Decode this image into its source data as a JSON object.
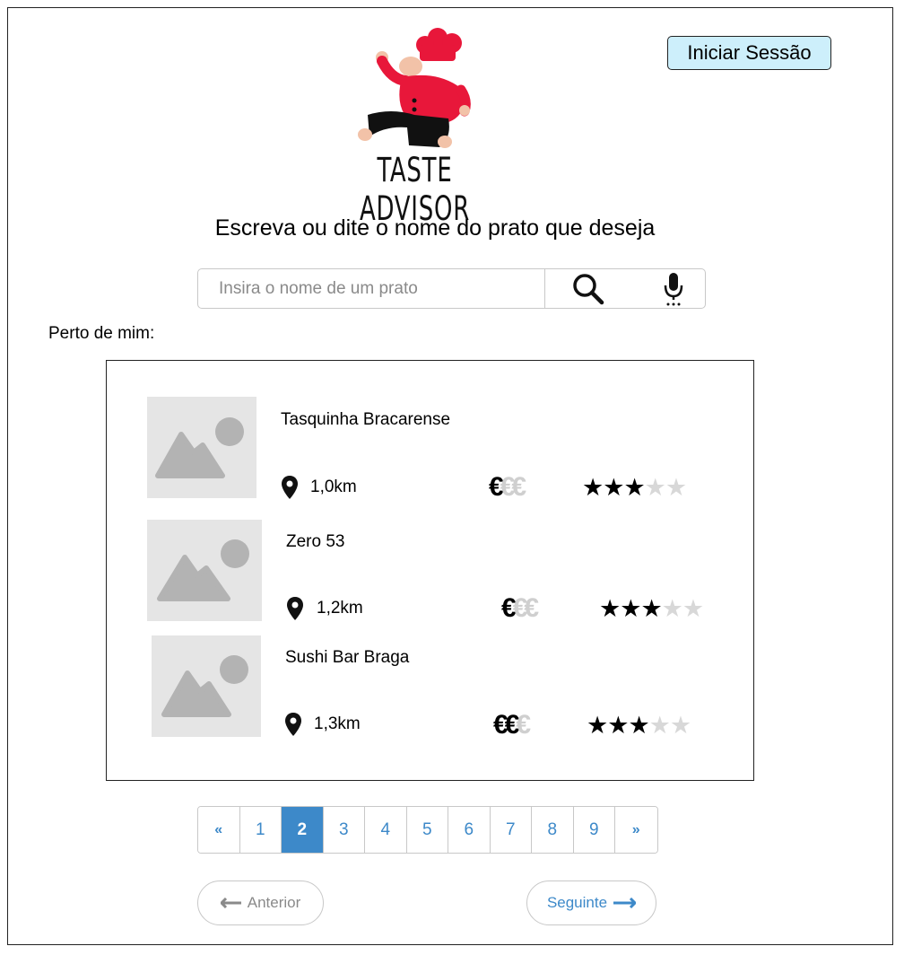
{
  "header": {
    "login_label": "Iniciar Sessão",
    "logo_text": "TASTE ADVISOR"
  },
  "search": {
    "prompt": "Escreva ou dite o nome do prato que deseja",
    "placeholder": "Insira o nome de um prato"
  },
  "near_me": {
    "label": "Perto de mim:",
    "restaurants": [
      {
        "name": "Tasquinha Bracarense",
        "distance": "1,0km",
        "price_level": 1,
        "price_max": 3,
        "rating": 3,
        "rating_max": 5
      },
      {
        "name": "Zero 53",
        "distance": "1,2km",
        "price_level": 1,
        "price_max": 3,
        "rating": 3,
        "rating_max": 5
      },
      {
        "name": "Sushi Bar Braga",
        "distance": "1,3km",
        "price_level": 2,
        "price_max": 3,
        "rating": 3,
        "rating_max": 5
      }
    ]
  },
  "pagination": {
    "first": "«",
    "pages": [
      "1",
      "2",
      "3",
      "4",
      "5",
      "6",
      "7",
      "8",
      "9"
    ],
    "last": "»",
    "current_page": "2"
  },
  "navigation": {
    "prev_label": "Anterior",
    "next_label": "Seguinte"
  },
  "colors": {
    "accent": "#3d89c9",
    "login_bg": "#cdeffb",
    "chef_red": "#e8173a"
  }
}
